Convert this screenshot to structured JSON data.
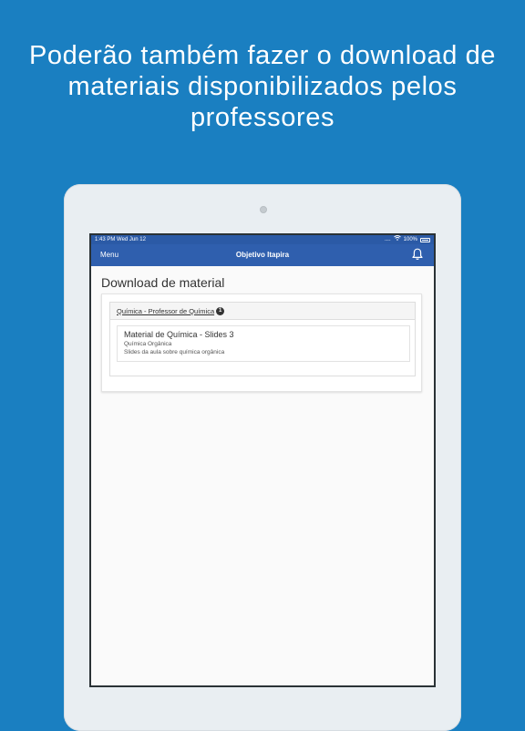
{
  "headline": {
    "line1": "Poderão também fazer o download de",
    "line2": "materiais disponibilizados pelos",
    "line3": "professores"
  },
  "colors": {
    "background": "#1a7fc1",
    "navbar": "#2f5fae",
    "statusbar": "#2b5aa6"
  },
  "statusbar": {
    "time_date": "1:43 PM   Wed Jun 12",
    "battery": "100%",
    "signal_dots": "....",
    "icons": [
      "wifi-icon",
      "battery-icon"
    ]
  },
  "navbar": {
    "menu_label": "Menu",
    "title": "Objetivo Itapira",
    "bell_icon": "bell-icon"
  },
  "page": {
    "title": "Download de material",
    "group": {
      "label": "Química - Professor de Química",
      "count": "1"
    },
    "materials": [
      {
        "title": "Material de Química - Slides 3",
        "subject": "Química Orgânica",
        "description": "Slides da aula sobre química orgânica"
      }
    ]
  }
}
